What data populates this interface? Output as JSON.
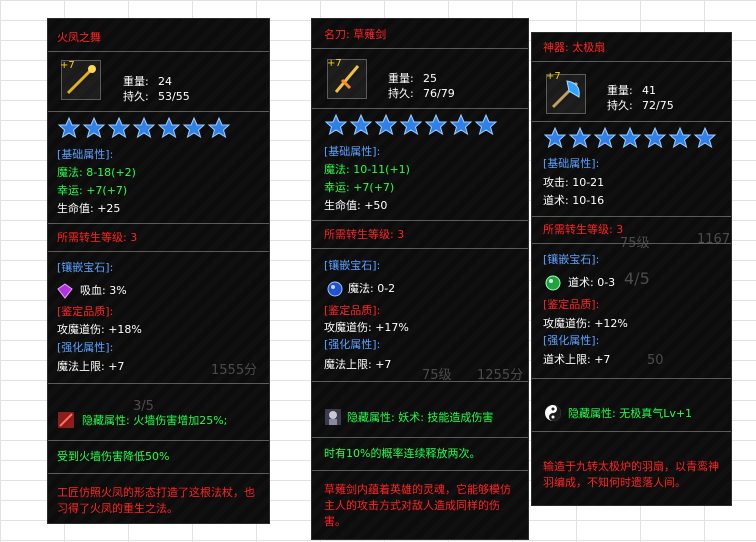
{
  "items": [
    {
      "title": "火凤之舞",
      "plus": "+7",
      "weight_label": "重量:",
      "weight": "24",
      "durability_label": "持久:",
      "durability": "53/55",
      "base_header": "[基础属性]:",
      "attr1": "魔法: 8-18(+2)",
      "attr2": "幸运: +7(+7)",
      "attr3": "生命值: +25",
      "rebirth": "所需转生等级: 3",
      "gem_header": "[镶嵌宝石]:",
      "gem_text": "吸血: 3%",
      "quality_header": "[鉴定品质]:",
      "quality_text": "攻魔道伤: +18%",
      "enhance_header": "[强化属性]:",
      "enhance_text": "魔法上限: +7",
      "hidden": "隐藏属性: 火墙伤害增加25%;",
      "extra": "受到火墙伤害降低50%",
      "desc": "工匠仿照火凤的形态打造了这根法杖，也习得了火凤的重生之法。",
      "bg_numbers": [
        "1555分",
        "3/5"
      ]
    },
    {
      "title": "名刀: 草薙剑",
      "plus": "+7",
      "weight_label": "重量:",
      "weight": "25",
      "durability_label": "持久:",
      "durability": "76/79",
      "base_header": "[基础属性]:",
      "attr1": "魔法: 10-11(+1)",
      "attr2": "幸运: +7(+7)",
      "attr3": "生命值: +50",
      "rebirth": "所需转生等级: 3",
      "gem_header": "[镶嵌宝石]:",
      "gem_text": "魔法: 0-2",
      "quality_header": "[鉴定品质]:",
      "quality_text": "攻魔道伤: +17%",
      "enhance_header": "[强化属性]:",
      "enhance_text": "魔法上限: +7",
      "hidden": "隐藏属性: 妖术: 技能造成伤害",
      "extra": "时有10%的概率连续释放两次。",
      "desc": "草薙剑内蕴着英雄的灵魂，它能够模仿主人的攻击方式对敌人造成同样的伤害。",
      "bg_numbers": [
        "1255分",
        "75级"
      ]
    },
    {
      "title": "神器: 太极扇",
      "plus": "+7",
      "weight_label": "重量:",
      "weight": "41",
      "durability_label": "持久:",
      "durability": "72/75",
      "base_header": "[基础属性]:",
      "attr1": "攻击: 10-21",
      "attr2": "道术: 10-16",
      "rebirth": "所需转生等级: 3",
      "gem_header": "[镶嵌宝石]:",
      "gem_text": "道术: 0-3",
      "quality_header": "[鉴定品质]:",
      "quality_text": "攻魔道伤: +12%",
      "enhance_header": "[强化属性]:",
      "enhance_text": "道术上限: +7",
      "hidden": "隐藏属性: 无极真气Lv+1",
      "desc": "输造于九转太极炉的羽扇，以青鸾神羽编成，不知何时遗落人间。",
      "bg_numbers": [
        "1167",
        "4/5",
        "75级",
        "50"
      ]
    }
  ],
  "colors": {
    "title": "#ff2222",
    "header": "#5aa0ff",
    "green": "#21ff4a",
    "star": "#2f7fe8"
  }
}
